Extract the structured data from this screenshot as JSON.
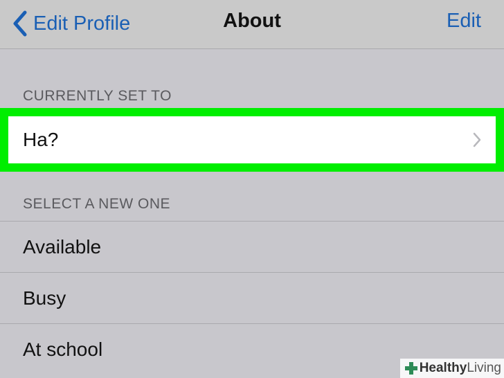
{
  "navbar": {
    "back_label": "Edit Profile",
    "title": "About",
    "edit_label": "Edit"
  },
  "current": {
    "header": "CURRENTLY SET TO",
    "value": "Ha?"
  },
  "choices": {
    "header": "SELECT A NEW ONE",
    "items": [
      {
        "label": "Available"
      },
      {
        "label": "Busy"
      },
      {
        "label": "At school"
      }
    ]
  },
  "watermark": {
    "part1": "Healthy",
    "part2": "Living"
  },
  "colors": {
    "accent": "#1a5fb4",
    "highlight": "#00ee00",
    "background": "#c8c7cc"
  }
}
